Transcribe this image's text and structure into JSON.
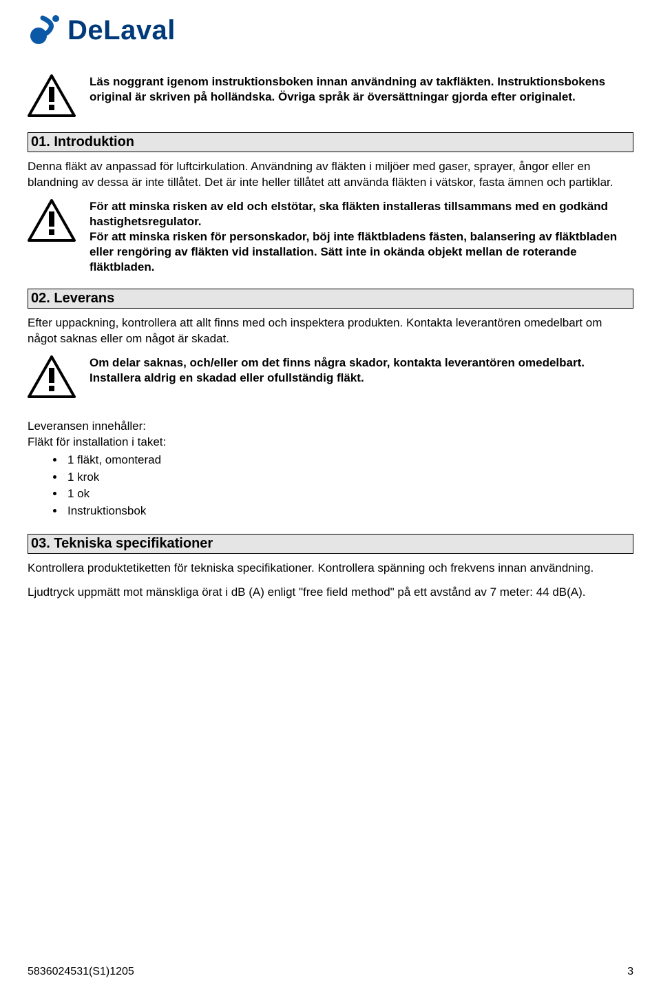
{
  "logo": {
    "brand_text": "DeLaval"
  },
  "warn1": {
    "text": "Läs noggrant igenom instruktionsboken innan användning av takfläkten. Instruktionsbokens original är skriven på holländska. Övriga språk är översättningar gjorda efter originalet."
  },
  "sections": {
    "s01": {
      "heading": "01. Introduktion",
      "body": "Denna fläkt av anpassad för luftcirkulation. Användning av fläkten i miljöer med gaser, sprayer, ångor eller en blandning av dessa är inte tillåtet. Det är inte heller tillåtet att använda fläkten i vätskor, fasta ämnen och partiklar."
    },
    "warn2": {
      "p1": "För att minska risken av eld och elstötar, ska fläkten installeras tillsammans med en godkänd hastighetsregulator.",
      "p2": "För att minska risken för personskador, böj inte fläktbladens fästen, balansering av fläktbladen eller rengöring av fläkten vid installation. Sätt inte in okända objekt mellan de roterande fläktbladen."
    },
    "s02": {
      "heading": "02. Leverans",
      "body": "Efter uppackning, kontrollera att allt finns med och inspektera produkten. Kontakta leverantören omedelbart om något saknas eller om något är skadat."
    },
    "warn3": {
      "text": "Om delar saknas, och/eller om det finns några skador, kontakta leverantören omedelbart. Installera aldrig en skadad eller ofullständig fläkt."
    },
    "delivery": {
      "line1": "Leveransen innehåller:",
      "line2": "Fläkt för installation i taket:",
      "items": [
        "1 fläkt, omonterad",
        "1 krok",
        "1 ok",
        "Instruktionsbok"
      ]
    },
    "s03": {
      "heading": "03. Tekniska specifikationer",
      "body1": "Kontrollera produktetiketten för tekniska specifikationer. Kontrollera spänning och frekvens innan användning.",
      "body2": "Ljudtryck uppmätt mot mänskliga örat i dB (A) enligt \"free field method\" på ett avstånd av 7 meter: 44 dB(A)."
    }
  },
  "footer": {
    "left": "5836024531(S1)1205",
    "right": "3"
  }
}
